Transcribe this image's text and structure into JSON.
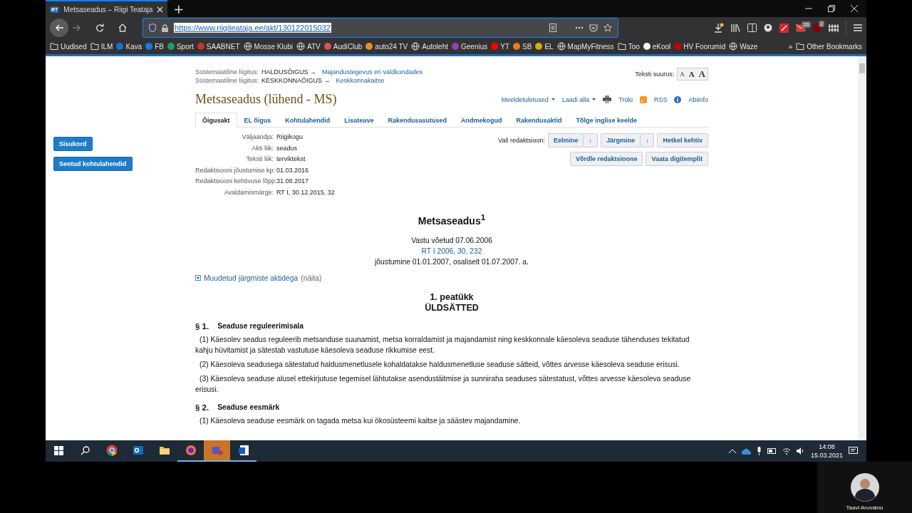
{
  "browser": {
    "tabs": [
      {
        "favicon": "RT",
        "title": "Metsaseadus – Riigi Teataja",
        "selected": true
      }
    ],
    "new_tab": "+",
    "url": "https://www.riigiteataja.ee/akt/130122015032",
    "bookmarks": [
      {
        "label": "Uudised",
        "kind": "folder"
      },
      {
        "label": "ILM",
        "kind": "folder"
      },
      {
        "label": "Kava",
        "kind": "site",
        "color": "#1a6fd1"
      },
      {
        "label": "FB",
        "kind": "site",
        "color": "#1877f2"
      },
      {
        "label": "Sport",
        "kind": "site",
        "color": "#1aa260"
      },
      {
        "label": "SAABNET",
        "kind": "site",
        "color": "#c0392b"
      },
      {
        "label": "Mosse Klubi",
        "kind": "page"
      },
      {
        "label": "ATV",
        "kind": "page"
      },
      {
        "label": "AudiClub",
        "kind": "site",
        "color": "#d9534f"
      },
      {
        "label": "auto24 TV",
        "kind": "site",
        "color": "#f08a24"
      },
      {
        "label": "Autoleht",
        "kind": "page"
      },
      {
        "label": "Geenius",
        "kind": "site",
        "color": "#8e44ad"
      },
      {
        "label": "YT",
        "kind": "site",
        "color": "#ff0000"
      },
      {
        "label": "SB",
        "kind": "site",
        "color": "#e67e22"
      },
      {
        "label": "EL",
        "kind": "site",
        "color": "#d4ac0d"
      },
      {
        "label": "MapMyFitness",
        "kind": "page"
      },
      {
        "label": "Too",
        "kind": "folder"
      },
      {
        "label": "eKool",
        "kind": "site",
        "color": "#f5f5f5"
      },
      {
        "label": "HV Foorumid",
        "kind": "site",
        "color": "#cc0000"
      },
      {
        "label": "Waze",
        "kind": "page"
      }
    ],
    "more_bookmarks": "»",
    "other_bookmarks": "Other Bookmarks",
    "mail_badge": "26",
    "addon_badge": "2"
  },
  "page": {
    "classification": [
      {
        "label": "Süstemaatiline liigitus:",
        "domain": "HALDUSÕIGUS →",
        "topic": "Majandustegevus eri valdkondades"
      },
      {
        "label": "Süstemaatiline liigitus:",
        "domain": "KESKKONNAÕIGUS →",
        "topic": "Keskkonnakaitse"
      }
    ],
    "text_size": {
      "label": "Teksti suurus:",
      "options": [
        "A",
        "A",
        "A"
      ]
    },
    "title": "Metsaseadus (lühend - MS)",
    "actions": [
      {
        "label": "Meeldetuletused",
        "kind": "menu"
      },
      {
        "label": "Laadi alla",
        "kind": "menu"
      },
      {
        "label": "Trüki",
        "kind": "print"
      },
      {
        "label": "RSS",
        "kind": "rss"
      },
      {
        "label": "Abiinfo",
        "kind": "info"
      }
    ],
    "tabs": [
      {
        "label": "Õigusakt",
        "selected": true
      },
      {
        "label": "EL õigus",
        "selected": false
      },
      {
        "label": "Kohtulahendid",
        "selected": false
      },
      {
        "label": "Lisateave",
        "selected": false
      },
      {
        "label": "Rakendusasutused",
        "selected": false
      },
      {
        "label": "Andmekogud",
        "selected": false
      },
      {
        "label": "Rakendusaktid",
        "selected": false
      },
      {
        "label": "Tõlge inglise keelde",
        "selected": false
      }
    ],
    "side_buttons": [
      "Sisukord",
      "Seotud kohtulahendid"
    ],
    "meta": [
      {
        "label": "Väljaandja:",
        "value": "Riigikogu"
      },
      {
        "label": "Akti liik:",
        "value": "seadus"
      },
      {
        "label": "Teksti liik:",
        "value": "terviktekst"
      },
      {
        "label": "Redaktsiooni jõustumise kp:",
        "value": "01.03.2016"
      },
      {
        "label": "Redaktsiooni kehtivuse lõpp:",
        "value": "31.08.2017"
      },
      {
        "label": "Avaldamismärge:",
        "value": "RT I, 30.12.2015, 32"
      }
    ],
    "version": {
      "label": "Vali redaktsioon:",
      "buttons": [
        {
          "label": "Eelmine",
          "menu": "↓"
        },
        {
          "label": "Järgmine",
          "menu": "↓"
        },
        {
          "label": "Hetkel kehtiv"
        }
      ],
      "buttons_2": [
        "Võrdle redaktsioone",
        "Vaata digitemplit"
      ]
    },
    "document": {
      "heading": "Metsaseadus$^{1}$",
      "adopted": "Vastu võetud 07.06.2006",
      "publication": "RT I 2006, 30, 232",
      "effective": "jõustumine 01.01.2007, osaliselt 01.07.2007. a.",
      "amended": {
        "link": "Muudetud järgmiste aktidega",
        "note": "(näita)",
        "expanded": false
      },
      "chapter_number": "1. peatükk",
      "chapter_title": "ÜLDSÄTTED",
      "sections": [
        {
          "number": "§ 1.",
          "title": "Seaduse reguleerimisala",
          "paragraphs": [
            "(1) Käesolev seadus reguleerib metsanduse suunamist, metsa korraldamist ja majandamist ning keskkonnale käesoleva seaduse tähenduses tekitatud kahju hüvitamist ja sätestab vastutuse käesoleva seaduse rikkumise eest.",
            "(2) Käesoleva seadusega sätestatud haldusmenetlusele kohaldatakse haldusmenetluse seaduse sätteid, võttes arvesse käesoleva seaduse erisusi.",
            "(3) Käesoleva seaduse alusel ettekirjutuse tegemisel lähtutakse asendustäitmise ja sunniraha seaduses sätestatust, võttes arvesse käesoleva seaduse erisusi."
          ]
        },
        {
          "number": "§ 2.",
          "title": "Seaduse eesmärk",
          "paragraphs": [
            "(1) Käesoleva seaduse eesmärk on tagada metsa kui ökosüsteemi kaitse ja säästev majandamine."
          ]
        }
      ]
    }
  },
  "taskbar": {
    "apps": [
      {
        "kind": "chrome",
        "running": false,
        "attention": false
      },
      {
        "kind": "outlook",
        "running": false,
        "attention": false
      },
      {
        "kind": "explorer",
        "running": false,
        "attention": false
      },
      {
        "kind": "firefox",
        "running": true,
        "attention": false
      },
      {
        "kind": "teams",
        "running": true,
        "attention": true
      },
      {
        "kind": "word",
        "running": true,
        "attention": false
      }
    ],
    "time": "14:08",
    "date": "15.03.2021"
  },
  "participant": {
    "name": "Taavi Aruvainu"
  }
}
